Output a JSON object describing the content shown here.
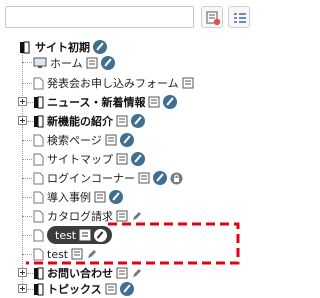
{
  "search": {
    "placeholder": "",
    "value": ""
  },
  "toolbar": {
    "dialog_icon": "form-edit-icon",
    "list_icon": "list-view-icon"
  },
  "tree": {
    "root": {
      "label": "サイト初期"
    },
    "items": [
      {
        "label": "ホーム",
        "icon": "computer-icon"
      },
      {
        "label": "発表会お申し込みフォーム",
        "icon": "page-icon"
      },
      {
        "label": "ニュース・新着情報",
        "icon": "folder-icon"
      },
      {
        "label": "新機能の紹介",
        "icon": "folder-icon"
      },
      {
        "label": "検索ページ",
        "icon": "page-icon"
      },
      {
        "label": "サイトマップ",
        "icon": "page-icon"
      },
      {
        "label": "ログインコーナー",
        "icon": "page-icon"
      },
      {
        "label": "導入事例",
        "icon": "page-icon"
      },
      {
        "label": "カタログ請求",
        "icon": "page-icon"
      },
      {
        "label": "test",
        "icon": "page-icon",
        "selected": true
      },
      {
        "label": "test",
        "icon": "page-icon"
      },
      {
        "label": "お問い合わせ",
        "icon": "folder-icon"
      },
      {
        "label": "トピックス",
        "icon": "folder-icon"
      }
    ]
  },
  "colors": {
    "accent": "#3f6f93",
    "highlight": "#e50012",
    "selected_bg": "#3c3c3c"
  }
}
